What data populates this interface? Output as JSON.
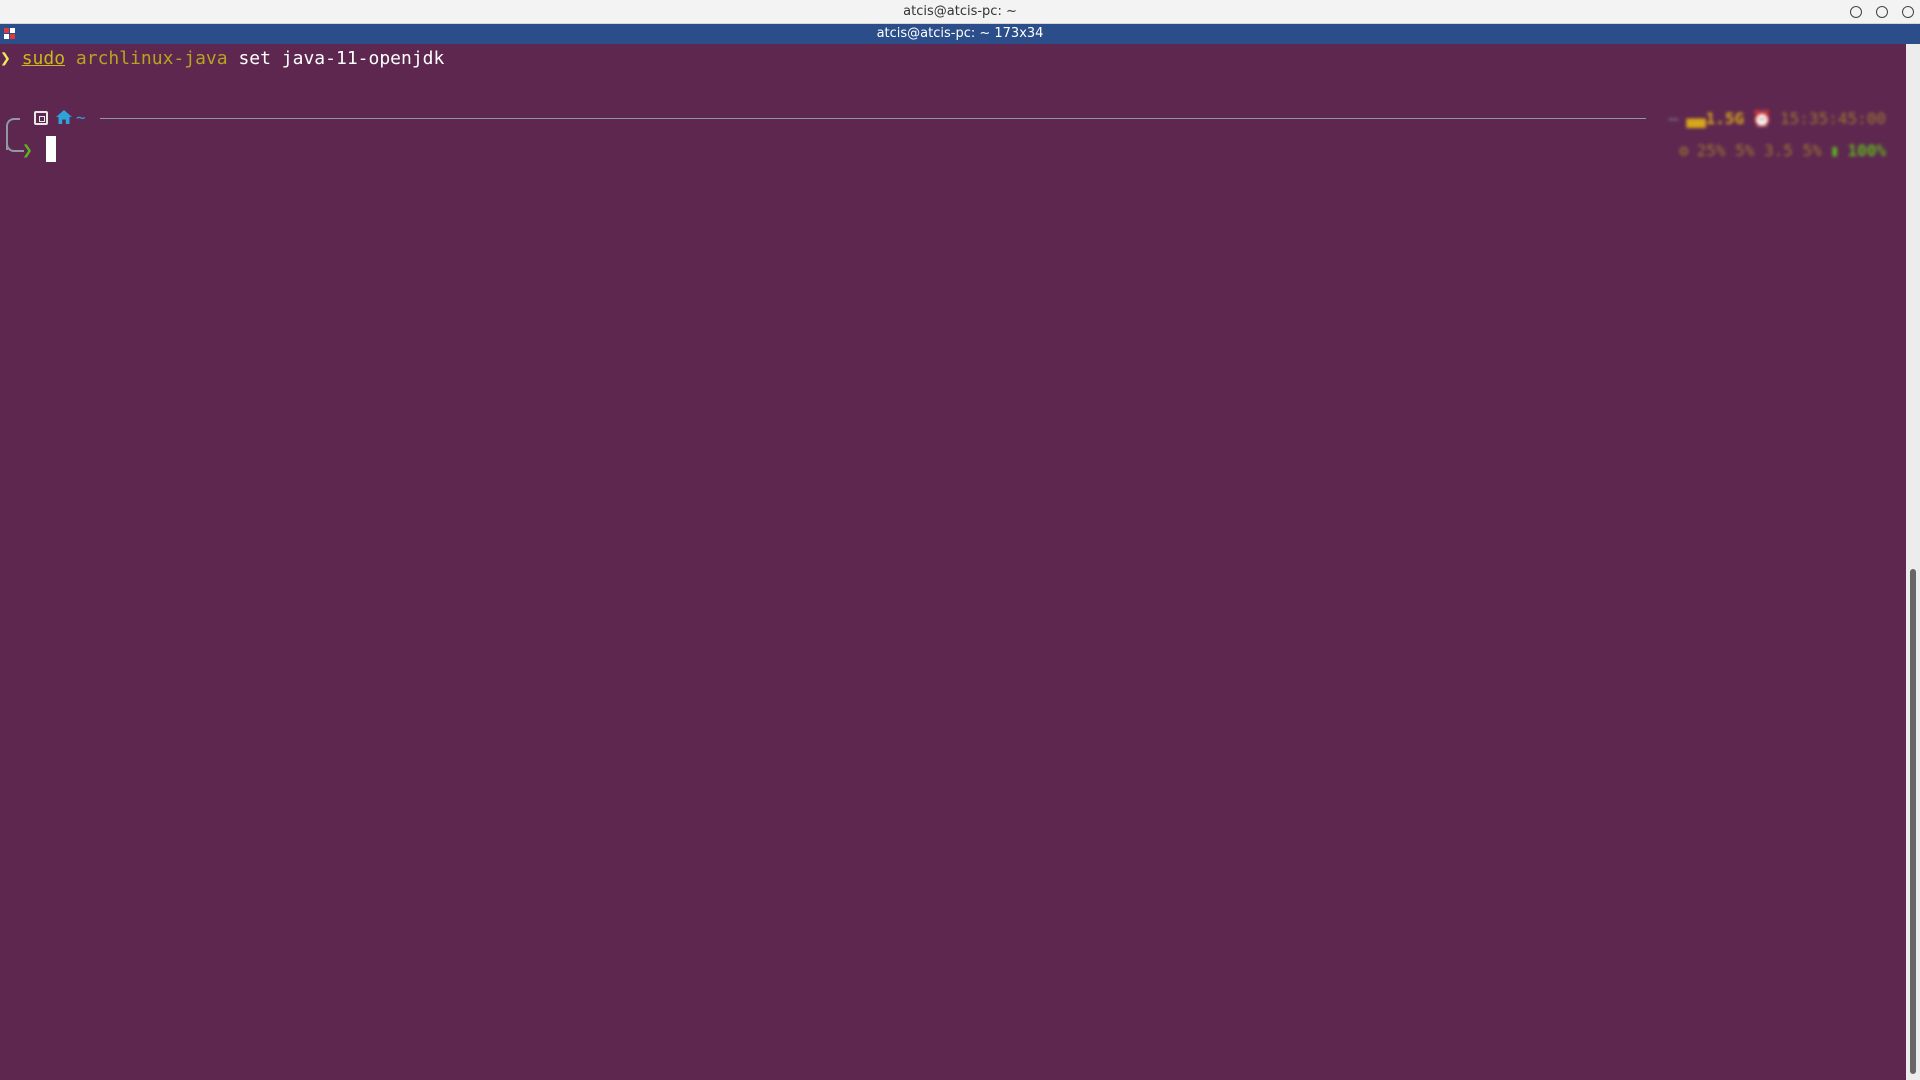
{
  "window": {
    "title": "atcis@atcis-pc: ~"
  },
  "tab": {
    "title": "atcis@atcis-pc: ~ 173x34"
  },
  "terminal": {
    "background": "#5e2750",
    "history": {
      "prompt_symbol": "❯",
      "cmd_sudo": "sudo",
      "cmd_name": "archlinux-java",
      "cmd_args": "set java-11-openjdk"
    },
    "prompt": {
      "path": "~",
      "input_chevron": "❯",
      "cursor": " "
    },
    "right_status": {
      "line1_dash": "—",
      "memory": "▄▄1.5G",
      "clock_icon": "⏰",
      "time": "15:35:45:00",
      "line2_load_icon": "⚙",
      "load": "25%  5%  3.5  5%",
      "battery_icon": "▮",
      "battery": "100%"
    }
  }
}
